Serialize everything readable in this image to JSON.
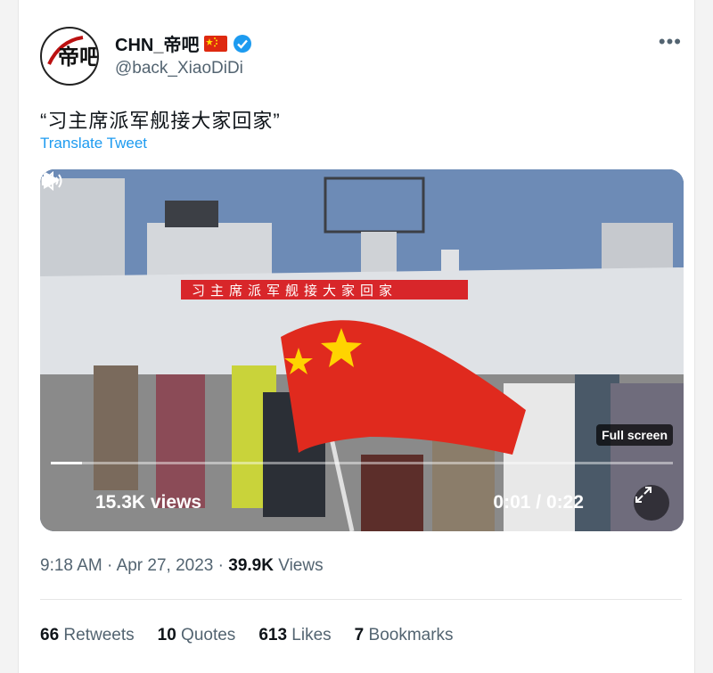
{
  "author": {
    "display_name": "CHN_帝吧",
    "handle": "@back_XiaoDiDi",
    "avatar_text": "帝吧"
  },
  "tweet": {
    "text": "“习主席派军舰接大家回家”",
    "translate_label": "Translate Tweet",
    "banner_text": "习主席派军舰接大家回家"
  },
  "video": {
    "views": "15.3K views",
    "time": "0:01 / 0:22",
    "progress": 0.05,
    "fullscreen_tip": "Full screen"
  },
  "meta": {
    "time": "9:18 AM",
    "date": "Apr 27, 2023",
    "views_count": "39.9K",
    "views_label": "Views"
  },
  "stats": [
    {
      "count": "66",
      "label": "Retweets"
    },
    {
      "count": "10",
      "label": "Quotes"
    },
    {
      "count": "613",
      "label": "Likes"
    },
    {
      "count": "7",
      "label": "Bookmarks"
    }
  ],
  "icons": {
    "verified": "verified-badge-icon",
    "more": "more-options-icon",
    "play": "play-icon",
    "volume": "volume-icon",
    "expand": "expand-icon",
    "flag": "china-flag-emoji"
  },
  "colors": {
    "accent": "#1d9bf0",
    "muted": "#536471",
    "banner_red": "#d8262a"
  }
}
